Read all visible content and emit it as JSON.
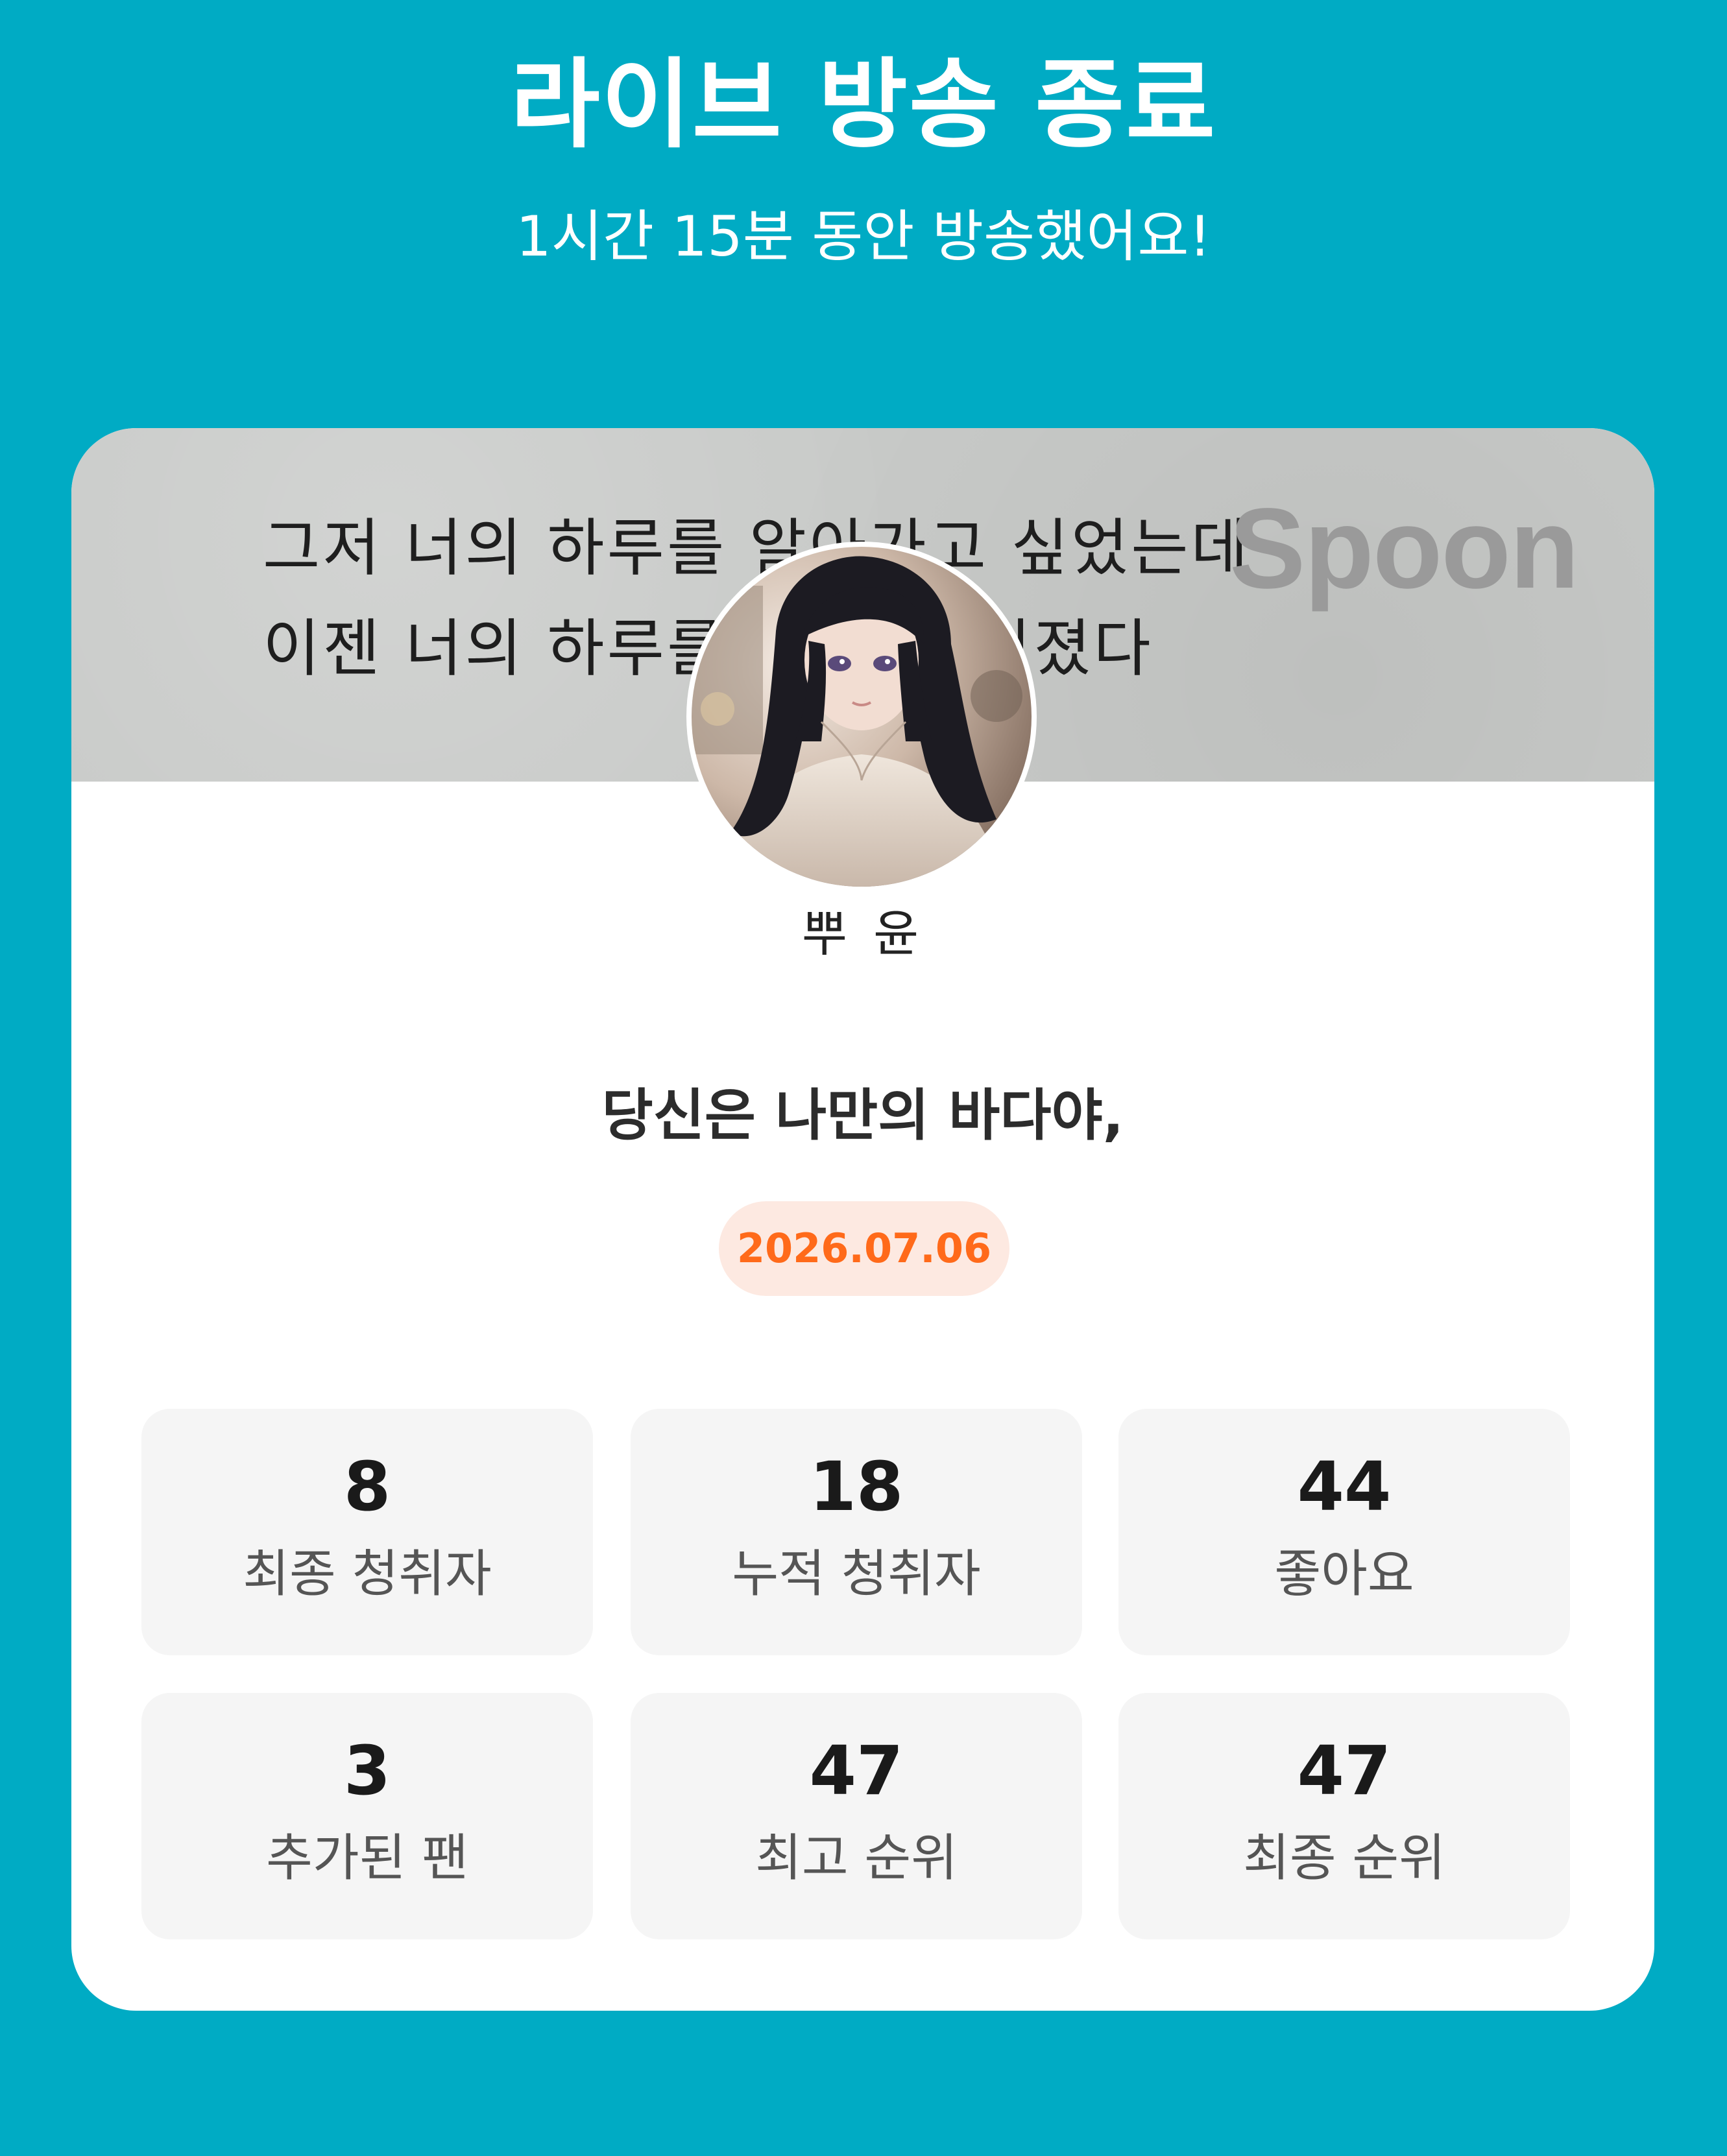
{
  "header": {
    "title": "라이브 방송 종료",
    "subtitle": "1시간 15분 동안 방송했어요!"
  },
  "banner": {
    "line1": "그저 너의 하루를 알아가고 싶었는데",
    "line2": "이젠 너의 하루를 알 수 없어졌다",
    "logo": "Spoon"
  },
  "profile": {
    "avatar_icon": "profile-avatar-photo",
    "username": "뿌 윤"
  },
  "broadcast": {
    "title": "당신은 나만의 바다야,",
    "date": "2026.07.06"
  },
  "stats": [
    {
      "value": "8",
      "label": "최종 청취자"
    },
    {
      "value": "18",
      "label": "누적 청취자"
    },
    {
      "value": "44",
      "label": "좋아요"
    },
    {
      "value": "3",
      "label": "추가된 팬"
    },
    {
      "value": "47",
      "label": "최고 순위"
    },
    {
      "value": "47",
      "label": "최종 순위"
    }
  ],
  "colors": {
    "background": "#00abc4",
    "card": "#ffffff",
    "date_text": "#ff6a1a",
    "date_bg": "#fde9e1",
    "stat_bg": "#f5f5f5"
  }
}
